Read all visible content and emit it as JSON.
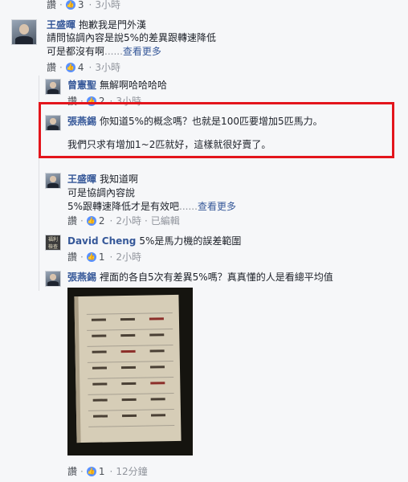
{
  "comments": [
    {
      "meta_top": {
        "like": "讚",
        "likes": "3",
        "time": "3小時"
      }
    },
    {
      "author": "王盛暉",
      "line1": "抱歉我是門外漢",
      "line2": "請問協調內容是說5%的差異跟轉速降低",
      "line3": "可是都沒有啊",
      "see_more": "查看更多",
      "meta": {
        "like": "讚",
        "likes": "4",
        "time": "3小時"
      }
    },
    {
      "author": "曾憲聖",
      "text": "無解啊哈哈哈哈",
      "meta": {
        "like": "讚",
        "likes": "2",
        "time": "3小時"
      }
    },
    {
      "author": "張燕錫",
      "text": "你知道5%的概念嗎？也就是100匹要增加5匹馬力。",
      "line2": "我們只求有增加1~2匹就好，這樣就很好賣了。"
    },
    {
      "author": "王盛暉",
      "text": "我知道啊",
      "line2": "可是協調內容說",
      "line3": "5%跟轉速降低才是有效吧",
      "see_more": "查看更多",
      "meta": {
        "like": "讚",
        "likes": "2",
        "time": "2小時",
        "edited": "已編輯"
      }
    },
    {
      "author": "David Cheng",
      "text": "5%是馬力機的誤差範圍",
      "avatar_text": "福利\n檢查",
      "meta": {
        "like": "讚",
        "likes": "1",
        "time": "2小時"
      }
    },
    {
      "author": "張燕錫",
      "text": "裡面的各自5次有差異5%嗎？真真懂的人是看總平均值",
      "meta": {
        "like": "讚",
        "likes": "1",
        "time": "12分鐘"
      }
    }
  ],
  "ellipsis": "......",
  "colors": {
    "link": "#365899",
    "highlight": "#e3151c",
    "like_badge": "#5890ff"
  }
}
